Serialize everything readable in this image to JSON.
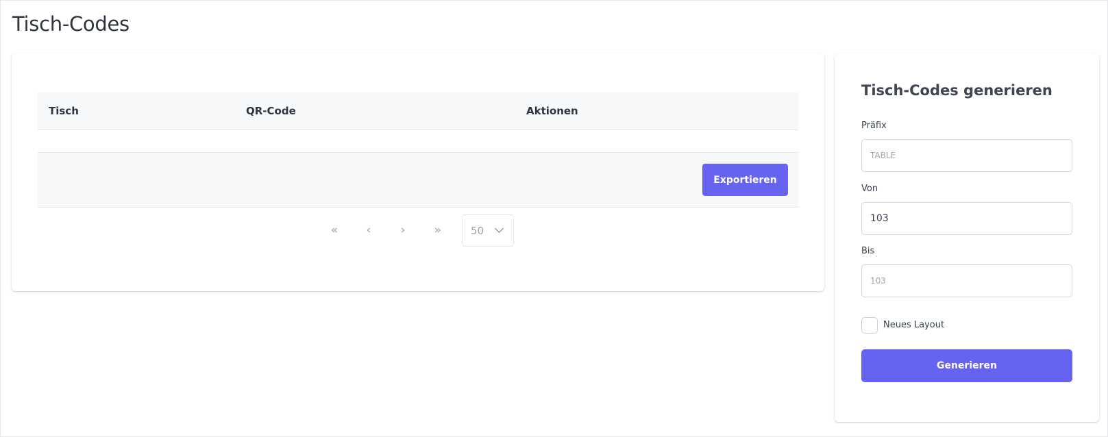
{
  "page": {
    "title": "Tisch-Codes"
  },
  "table": {
    "columns": [
      "Tisch",
      "QR-Code",
      "Aktionen"
    ],
    "rows": [],
    "export_label": "Exportieren"
  },
  "pagination": {
    "first_symbol": "«",
    "prev_symbol": "‹",
    "next_symbol": "›",
    "last_symbol": "»",
    "page_size": "50"
  },
  "form": {
    "title": "Tisch-Codes generieren",
    "prefix_label": "Präfix",
    "prefix_value": "",
    "prefix_placeholder": "TABLE",
    "from_label": "Von",
    "from_value": "103",
    "to_label": "Bis",
    "to_value": "",
    "to_placeholder": "103",
    "new_layout_label": "Neues Layout",
    "new_layout_checked": false,
    "submit_label": "Generieren"
  },
  "colors": {
    "accent": "#6563ef"
  }
}
